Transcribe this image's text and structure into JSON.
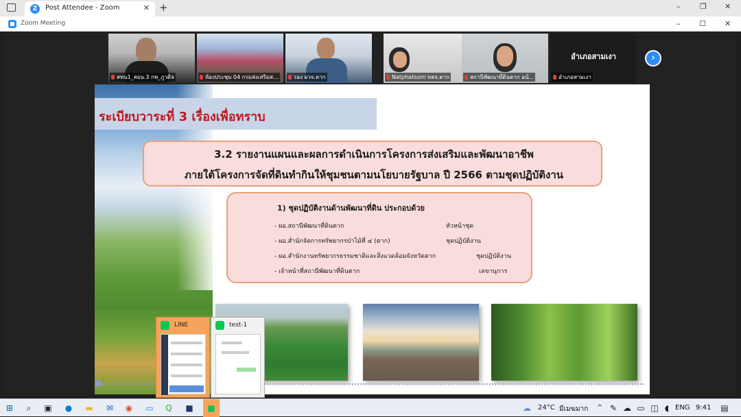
{
  "browser": {
    "tab_title": "Post Attendee - Zoom",
    "tab_close": "✕",
    "new_tab": "+",
    "controls": [
      "–",
      "❐",
      "✕"
    ]
  },
  "zoom_window": {
    "title": "Zoom Meeting",
    "controls": [
      "–",
      "☐",
      "✕"
    ]
  },
  "participants": [
    {
      "name": "สทน1_สอน.3 กพ_ภูวดิจ"
    },
    {
      "name": "ห้องประชุม 04 กรมส่งเสริมส..."
    },
    {
      "name": "รอง ผวจ.ตาก"
    },
    {
      "name": "Natphatsorn ทสจ.ตาก"
    },
    {
      "name": "สถานีพัฒนาที่ดินตาก อน์..."
    },
    {
      "name": "อำเภอสามเงา",
      "display_text": "อำเภอสามเงา"
    }
  ],
  "next_button": "›",
  "slide": {
    "title": "ระเบียบวาระที่ 3 เรื่องเพื่อทราบ",
    "heading_line1": "3.2 รายงานแผนและผลการดำเนินการโครงการส่งเสริมและพัฒนาอาชีพ",
    "heading_line2": "ภายใต้โครงการจัดที่ดินทำกินให้ชุมชนตามนโยบายรัฐบาล ปี 2566 ตามชุดปฏิบัติงาน",
    "list_heading": "1) ชุดปฏิบัติงานด้านพัฒนาที่ดิน ประกอบด้วย",
    "items": [
      {
        "left": "- ผอ.สถานีพัฒนาที่ดินตาก",
        "right": "หัวหน้าชุด"
      },
      {
        "left": "- ผอ.สำนักจัดการทรัพยากรป่าไม้ที่ ๔ (ตาก)",
        "right": "ชุดปฏิบัติงาน"
      },
      {
        "left": "- ผอ.สำนักงานทรัพยากรธรรมชาติและสิ่งแวดล้อมจังหวัดตาก",
        "right": "ชุดปฏิบัติงาน"
      },
      {
        "left": "- เจ้าหน้าที่สถานีพัฒนาที่ดินตาก",
        "right": "เลขานุการ"
      }
    ]
  },
  "previews": {
    "line_title": "LINE",
    "test_title": "test-1"
  },
  "taskbar": {
    "weather": "24°C",
    "weather_desc": "มีเมฆมาก",
    "lang": "ENG",
    "time": "9:41",
    "caret": "^"
  }
}
